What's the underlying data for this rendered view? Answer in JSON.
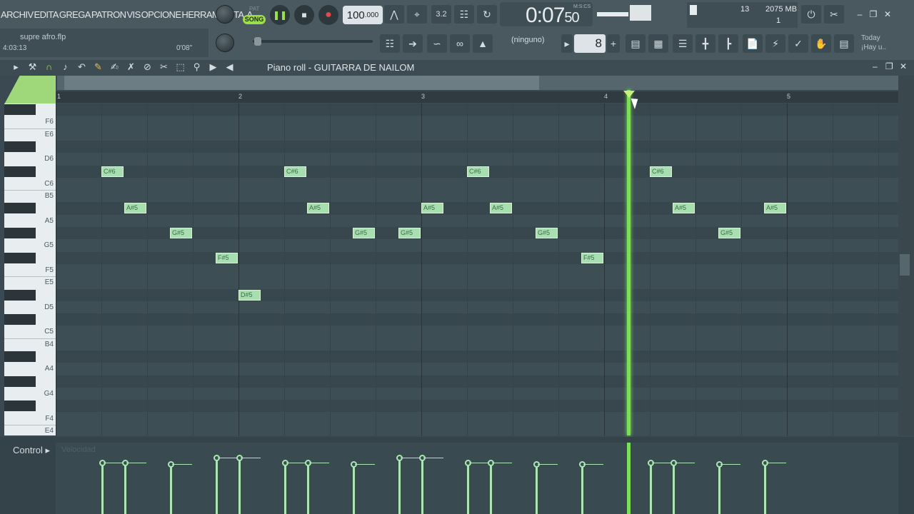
{
  "menu": [
    "ARCHIV",
    "EDITA",
    "GREGA",
    "PATRON",
    "VIS",
    "OPCIONE",
    "HERRAMIENTA"
  ],
  "file": {
    "name": "supre afro.flp",
    "time": "4:03:13",
    "t2": "0'08\""
  },
  "transport": {
    "pat": "PAT",
    "song": "SONG",
    "tempo": "100",
    "tempo_dec": ".000"
  },
  "time": {
    "value": "0:07",
    "sub": "50",
    "label": "M:S:CS"
  },
  "cpu": {
    "voices": "13",
    "mem": "2075 MB",
    "poly": "1"
  },
  "snap": "(ninguno)",
  "step": "8",
  "news": {
    "line1": "Today",
    "line2": "¡Hay u.."
  },
  "piano_roll": {
    "title": "Piano roll - GUITARRA DE NAILOM"
  },
  "ruler": [
    "1",
    "2",
    "3",
    "4",
    "5"
  ],
  "keys": [
    "F6",
    "E6",
    "D6",
    "C6",
    "B5",
    "A5",
    "G5",
    "F5",
    "E5",
    "D5",
    "C5",
    "B4",
    "A4",
    "G4",
    "F4",
    "E4"
  ],
  "notes": [
    {
      "label": "C#6"
    },
    {
      "label": "A#5"
    },
    {
      "label": "G#5"
    },
    {
      "label": "F#5"
    },
    {
      "label": "D#5"
    },
    {
      "label": "C#6"
    },
    {
      "label": "A#5"
    },
    {
      "label": "G#5"
    },
    {
      "label": "G#5"
    },
    {
      "label": "A#5"
    },
    {
      "label": "C#6"
    },
    {
      "label": "A#5"
    },
    {
      "label": "G#5"
    },
    {
      "label": "F#5"
    },
    {
      "label": "C#6"
    },
    {
      "label": "A#5"
    },
    {
      "label": "G#5"
    },
    {
      "label": "A#5"
    }
  ],
  "control": {
    "label": "Control",
    "param": "Velocidad"
  }
}
